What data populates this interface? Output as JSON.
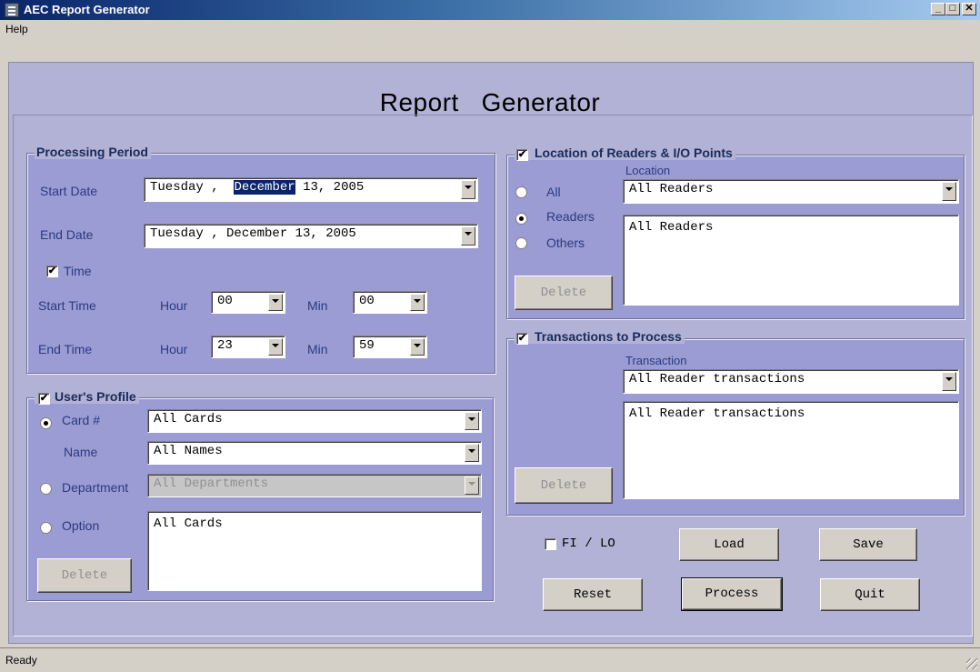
{
  "window": {
    "title": "AEC Report Generator"
  },
  "menu": {
    "help": "Help"
  },
  "page_title": "Report   Generator",
  "processing": {
    "legend": "Processing Period",
    "start_date_label": "Start Date",
    "start_day": "Tuesday ,",
    "start_month": "December",
    "start_rest": "13, 2005",
    "end_date_label": "End Date",
    "end_date": "Tuesday , December 13, 2005",
    "time_label": "Time",
    "time_checked": "✔",
    "start_time_label": "Start Time",
    "end_time_label": "End Time",
    "hour_label": "Hour",
    "min_label": "Min",
    "start_hour": "00",
    "start_min": "00",
    "end_hour": "23",
    "end_min": "59"
  },
  "user_profile": {
    "legend": "User's Profile",
    "checked": "✔",
    "card_label": "Card #",
    "card_value": "All Cards",
    "name_label": "Name",
    "name_value": "All Names",
    "department_label": "Department",
    "department_value": "All Departments",
    "option_label": "Option",
    "option_list": "All Cards",
    "delete_label": "Delete"
  },
  "location": {
    "legend": "Location of Readers & I/O Points",
    "checked": "✔",
    "sub_label": "Location",
    "radio_all": "All",
    "radio_readers": "Readers",
    "radio_others": "Others",
    "selected": "Readers",
    "combo_value": "All Readers",
    "list_value": "All Readers",
    "delete_label": "Delete"
  },
  "transactions": {
    "legend": "Transactions to Process",
    "checked": "✔",
    "sub_label": "Transaction",
    "combo_value": "All Reader transactions",
    "list_value": "All Reader transactions",
    "delete_label": "Delete"
  },
  "actions": {
    "fi_lo_label": "FI / LO",
    "load": "Load",
    "save": "Save",
    "reset": "Reset",
    "process": "Process",
    "quit": "Quit"
  },
  "status": {
    "text": "Ready"
  },
  "colors": {
    "panel": "#9c9cd4",
    "frame": "#b2b2d6",
    "label": "#2a3a80",
    "legend": "#1a2a5a",
    "title_bar": "#0a246a"
  }
}
